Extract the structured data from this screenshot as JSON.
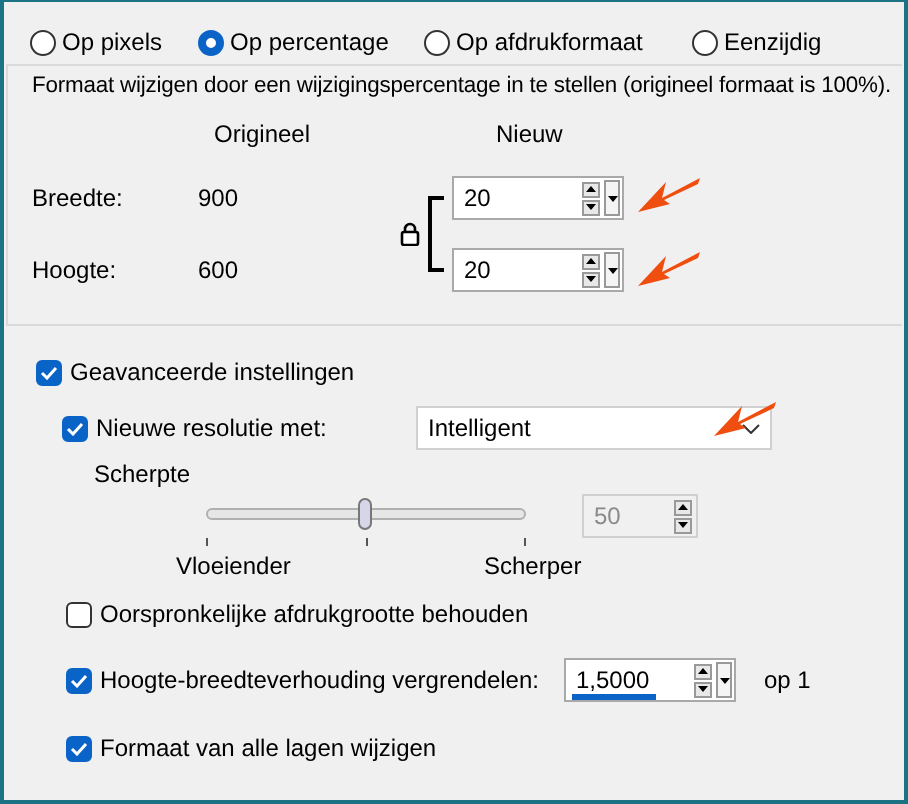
{
  "modes": [
    {
      "label": "Op pixels",
      "selected": false
    },
    {
      "label": "Op percentage",
      "selected": true
    },
    {
      "label": "Op afdrukformaat",
      "selected": false
    },
    {
      "label": "Eenzijdig",
      "selected": false
    }
  ],
  "resize_group": {
    "description": "Formaat wijzigen door een wijzigingspercentage in te stellen (origineel formaat  is 100%).",
    "column_headers": [
      "Origineel",
      "Nieuw"
    ],
    "rows": [
      {
        "label": "Breedte:",
        "original": "900",
        "new": "20"
      },
      {
        "label": "Hoogte:",
        "original": "600",
        "new": "20"
      }
    ]
  },
  "advanced": {
    "label": "Geavanceerde instellingen",
    "checked": true
  },
  "resample": {
    "label": "Nieuwe resolutie met:",
    "checked": true,
    "method": "Intelligent"
  },
  "sharpness": {
    "label": "Scherpte",
    "level": 0.5,
    "value": "50",
    "disabled": true,
    "min_label": "Vloeiender",
    "max_label": "Scherper"
  },
  "options": [
    {
      "kind": "checkbox",
      "label": "Oorspronkelijke afdrukgrootte behouden",
      "checked": false
    },
    {
      "kind": "ratio",
      "label": "Hoogte-breedteverhouding vergrendelen:",
      "checked": true,
      "value": "1,5000",
      "suffix": "op 1"
    },
    {
      "kind": "checkbox",
      "label": "Formaat van alle lagen wijzigen",
      "checked": true
    }
  ]
}
